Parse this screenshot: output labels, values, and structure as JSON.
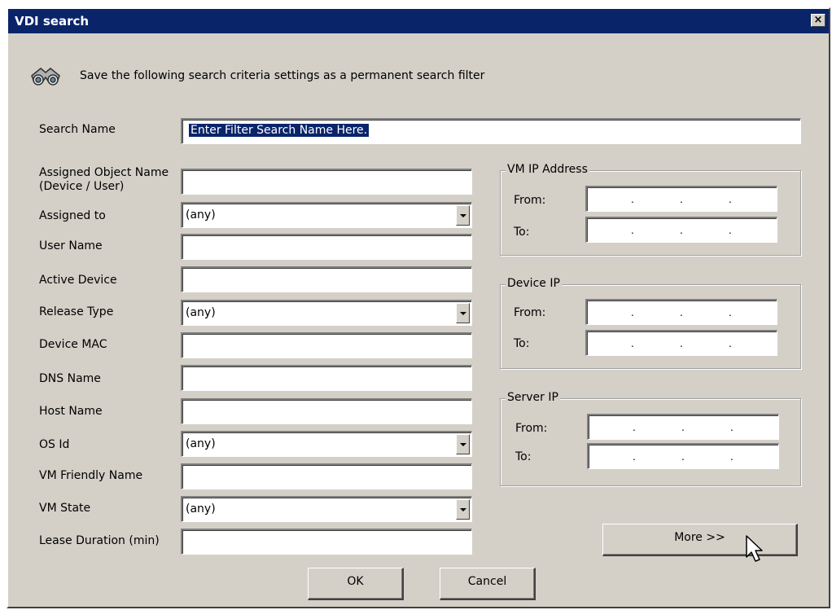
{
  "window": {
    "title": "VDI search",
    "close_glyph": "×"
  },
  "header": {
    "icon": "binoculars-icon",
    "text": "Save the following search criteria settings as a permanent search filter"
  },
  "search_name": {
    "label": "Search Name",
    "value": "Enter Filter Search Name Here."
  },
  "fields": {
    "assigned_object": {
      "label": "Assigned Object Name (Device / User)",
      "value": ""
    },
    "assigned_to": {
      "label": "Assigned to",
      "value": "(any)"
    },
    "user_name": {
      "label": "User Name",
      "value": ""
    },
    "active_device": {
      "label": "Active Device",
      "value": ""
    },
    "release_type": {
      "label": "Release Type",
      "value": "(any)"
    },
    "device_mac": {
      "label": "Device MAC",
      "value": ""
    },
    "dns_name": {
      "label": "DNS Name",
      "value": ""
    },
    "host_name": {
      "label": "Host Name",
      "value": ""
    },
    "os_id": {
      "label": "OS Id",
      "value": "(any)"
    },
    "vm_friendly_name": {
      "label": "VM Friendly Name",
      "value": ""
    },
    "vm_state": {
      "label": "VM State",
      "value": "(any)"
    },
    "lease_duration": {
      "label": "Lease Duration (min)",
      "value": ""
    }
  },
  "ip_groups": {
    "vm_ip": {
      "title": "VM IP Address",
      "from_label": "From:",
      "to_label": "To:"
    },
    "device_ip": {
      "title": "Device IP",
      "from_label": "From:",
      "to_label": "To:"
    },
    "server_ip": {
      "title": "Server IP",
      "from_label": "From:",
      "to_label": "To:"
    }
  },
  "ip_dot": ".",
  "buttons": {
    "more": "More >>",
    "ok": "OK",
    "cancel": "Cancel"
  },
  "colors": {
    "titlebar": "#0a246a",
    "dialog_bg": "#d4d0c8",
    "selection": "#0a246a"
  }
}
